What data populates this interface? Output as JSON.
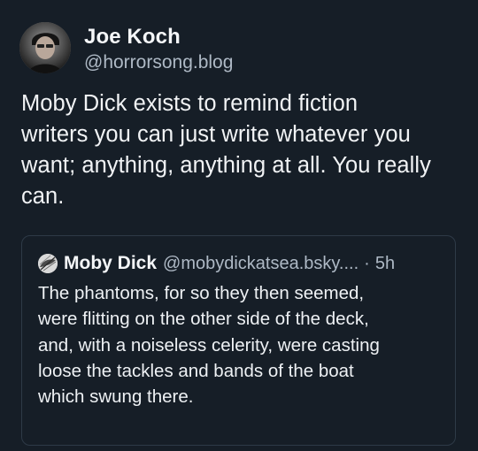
{
  "post": {
    "author": {
      "name": "Joe Koch",
      "handle": "@horrorsong.blog",
      "avatar_icon": "user-avatar"
    },
    "text_lines": [
      "Moby Dick exists to remind fiction",
      "writers you can just write whatever you",
      "want; anything, anything at all. You really",
      "can."
    ],
    "quote": {
      "author_name": "Moby Dick",
      "author_handle": "@mobydickatsea.bsky....",
      "separator": "·",
      "time": "5h",
      "avatar_icon": "whale-illustration-avatar",
      "text_lines": [
        "The phantoms, for so they then seemed,",
        "were flitting on the other side of the deck,",
        "and, with a noiseless celerity, were casting",
        "loose the tackles and bands of the boat",
        "which swung there."
      ]
    }
  },
  "colors": {
    "background": "#161e27",
    "primary_text": "#f1f3f5",
    "secondary_text": "#aeb9c5",
    "card_border": "#2e3a47"
  }
}
